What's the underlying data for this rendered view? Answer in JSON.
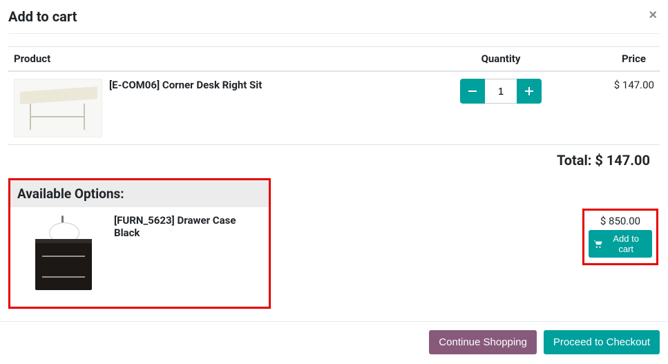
{
  "modal": {
    "title": "Add to cart",
    "close_label": "×"
  },
  "table": {
    "headers": {
      "product": "Product",
      "quantity": "Quantity",
      "price": "Price"
    },
    "items": [
      {
        "name": "[E-COM06] Corner Desk Right Sit",
        "qty": "1",
        "price": "$ 147.00"
      }
    ],
    "total_label": "Total:",
    "total_value": "$ 147.00"
  },
  "options": {
    "header": "Available Options:",
    "items": [
      {
        "name": "[FURN_5623] Drawer Case Black",
        "price": "$ 850.00",
        "add_label": "Add to cart"
      }
    ]
  },
  "footer": {
    "continue": "Continue Shopping",
    "checkout": "Proceed to Checkout"
  }
}
